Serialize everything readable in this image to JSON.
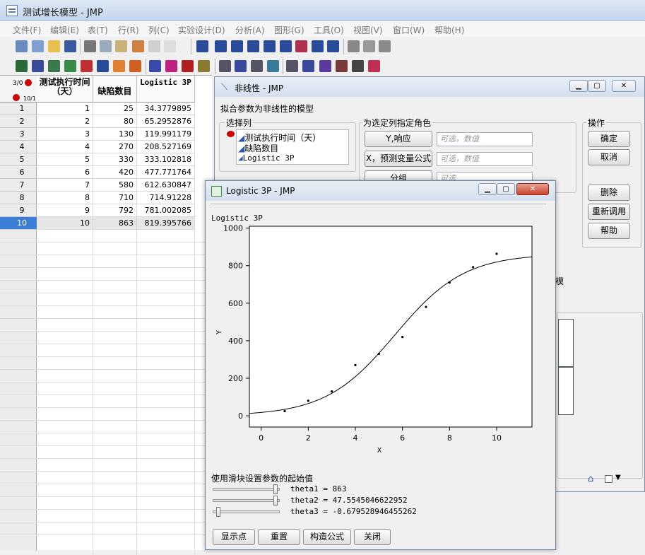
{
  "app": {
    "title": "测试增长模型 - JMP"
  },
  "menu": [
    "文件(F)",
    "编辑(E)",
    "表(T)",
    "行(R)",
    "列(C)",
    "实验设计(D)",
    "分析(A)",
    "图形(G)",
    "工具(O)",
    "视图(V)",
    "窗口(W)",
    "帮助(H)"
  ],
  "table": {
    "row_info_top": "3/0",
    "row_info_bottom": "10/1",
    "columns": [
      "测试执行时间（天）",
      "缺陷数目",
      "Logistic 3P"
    ],
    "rows": [
      [
        "1",
        "25",
        "34.3779895"
      ],
      [
        "2",
        "80",
        "65.2952876"
      ],
      [
        "3",
        "130",
        "119.991179"
      ],
      [
        "4",
        "270",
        "208.527169"
      ],
      [
        "5",
        "330",
        "333.102818"
      ],
      [
        "6",
        "420",
        "477.771764"
      ],
      [
        "7",
        "580",
        "612.630847"
      ],
      [
        "8",
        "710",
        "714.91228"
      ],
      [
        "9",
        "792",
        "781.002085"
      ],
      [
        "10",
        "863",
        "819.395766"
      ]
    ],
    "row_numbers": [
      "1",
      "2",
      "3",
      "4",
      "5",
      "6",
      "7",
      "8",
      "9",
      "10"
    ]
  },
  "nonlinear": {
    "title": "非线性 - JMP",
    "subtitle": "拟合参数为非线性的模型",
    "select_cols_label": "选择列",
    "columns": [
      "测试执行时间（天）",
      "缺陷数目",
      "Logistic 3P"
    ],
    "role_label": "为选定列指定角色",
    "y_btn": "Y,响应",
    "x_btn": "X，预测变量公式",
    "group_btn": "分组",
    "optional_placeholder": "可选，数值",
    "optional_placeholder2": "可选",
    "actions_label": "操作",
    "ok": "确定",
    "cancel": "取消",
    "remove": "删除",
    "recall": "重新调用",
    "help": "帮助",
    "partial_text": "置模"
  },
  "logistic": {
    "title": "Logistic 3P - JMP",
    "panel_title": "Logistic 3P",
    "slider_caption": "使用滑块设置参数的起始值",
    "params": [
      "theta1 = 863",
      "theta2 = 47.5545046622952",
      "theta3 = -0.679528946455262"
    ],
    "slider_levels": [
      0.97,
      0.97,
      0.05
    ],
    "buttons": [
      "显示点",
      "重置",
      "构造公式",
      "关闭"
    ]
  },
  "chart_data": {
    "type": "scatter",
    "title": "",
    "xlabel": "X",
    "ylabel": "Y",
    "xlim": [
      -0.5,
      11.5
    ],
    "ylim": [
      -60,
      1010
    ],
    "xticks": [
      0,
      2,
      4,
      6,
      8,
      10
    ],
    "yticks": [
      0,
      200,
      400,
      600,
      800,
      1000
    ],
    "points": {
      "x": [
        1,
        2,
        3,
        4,
        5,
        6,
        7,
        8,
        9,
        10
      ],
      "y": [
        25,
        80,
        130,
        270,
        330,
        420,
        580,
        710,
        792,
        863
      ]
    },
    "curve": {
      "name": "",
      "model": "logistic3p",
      "theta1": 863,
      "theta2": 47.5545046622952,
      "theta3": -0.679528946455262
    }
  }
}
